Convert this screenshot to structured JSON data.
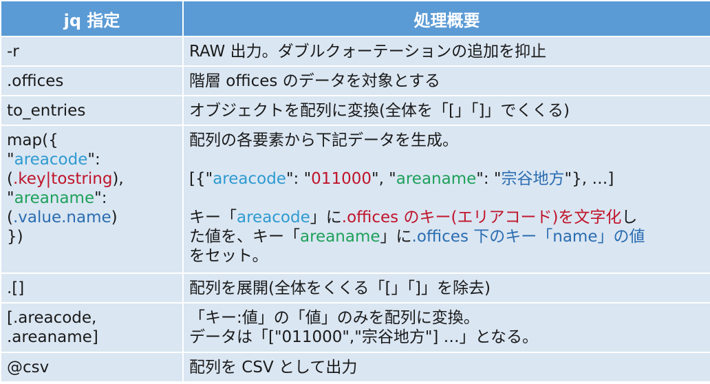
{
  "header": {
    "col1": "jq 指定",
    "col2": "処理概要"
  },
  "rows": [
    {
      "cmd": "-r",
      "desc": "RAW 出力。ダブルクォーテーションの追加を抑止"
    },
    {
      "cmd": ".offices",
      "desc": "階層 offices のデータを対象とする"
    },
    {
      "cmd": "to_entries",
      "desc": "オブジェクトを配列に変換(全体を「[」「]」でくくる)"
    },
    {
      "cmd": {
        "l1": "map({",
        "l2a": "\"",
        "l2b": "areacode",
        "l2c": "\":",
        "l3a": "(",
        "l3b": ".key|tostring",
        "l3c": "),",
        "l4a": "\"",
        "l4b": "areaname",
        "l4c": "\":",
        "l5a": "(",
        "l5b": ".value.name",
        "l5c": ")",
        "l6": "})"
      },
      "desc": {
        "p1": "配列の各要素から下記データを生成。",
        "p2": {
          "a": "[{\"",
          "b": "areacode",
          "c": "\": \"",
          "d": "011000",
          "e": "\", \"",
          "f": "areaname",
          "g": "\": \"",
          "h": "宗谷地方",
          "i": "\"}, …]"
        },
        "p3": {
          "a": "キー「",
          "b": "areacode",
          "c": "」に",
          "d": ".offices のキー(エリアコード)を文字化",
          "e": "し",
          "f": "た値を、キー「",
          "g": "areaname",
          "h": "」に",
          "i": ".offices 下のキー「name」の値",
          "j": "をセット。"
        }
      }
    },
    {
      "cmd": ".[]",
      "desc": "配列を展開(全体をくくる「[」「]」を除去)"
    },
    {
      "cmd": {
        "l1": "[.areacode,",
        "l2": ".areaname]"
      },
      "desc": {
        "l1": "「キー:値」の「値」のみを配列に変換。",
        "l2": "データは「[\"011000\",\"宗谷地方\"] …」となる。"
      }
    },
    {
      "cmd": "@csv",
      "desc": "配列を CSV として出力"
    }
  ],
  "colors": {
    "header_bg": "#5b9bd5",
    "cell_bg": "#dae6f2",
    "blue": "#2e9ad0",
    "red": "#c0142a",
    "green": "#1ea05a",
    "navy": "#2a6cb0"
  }
}
